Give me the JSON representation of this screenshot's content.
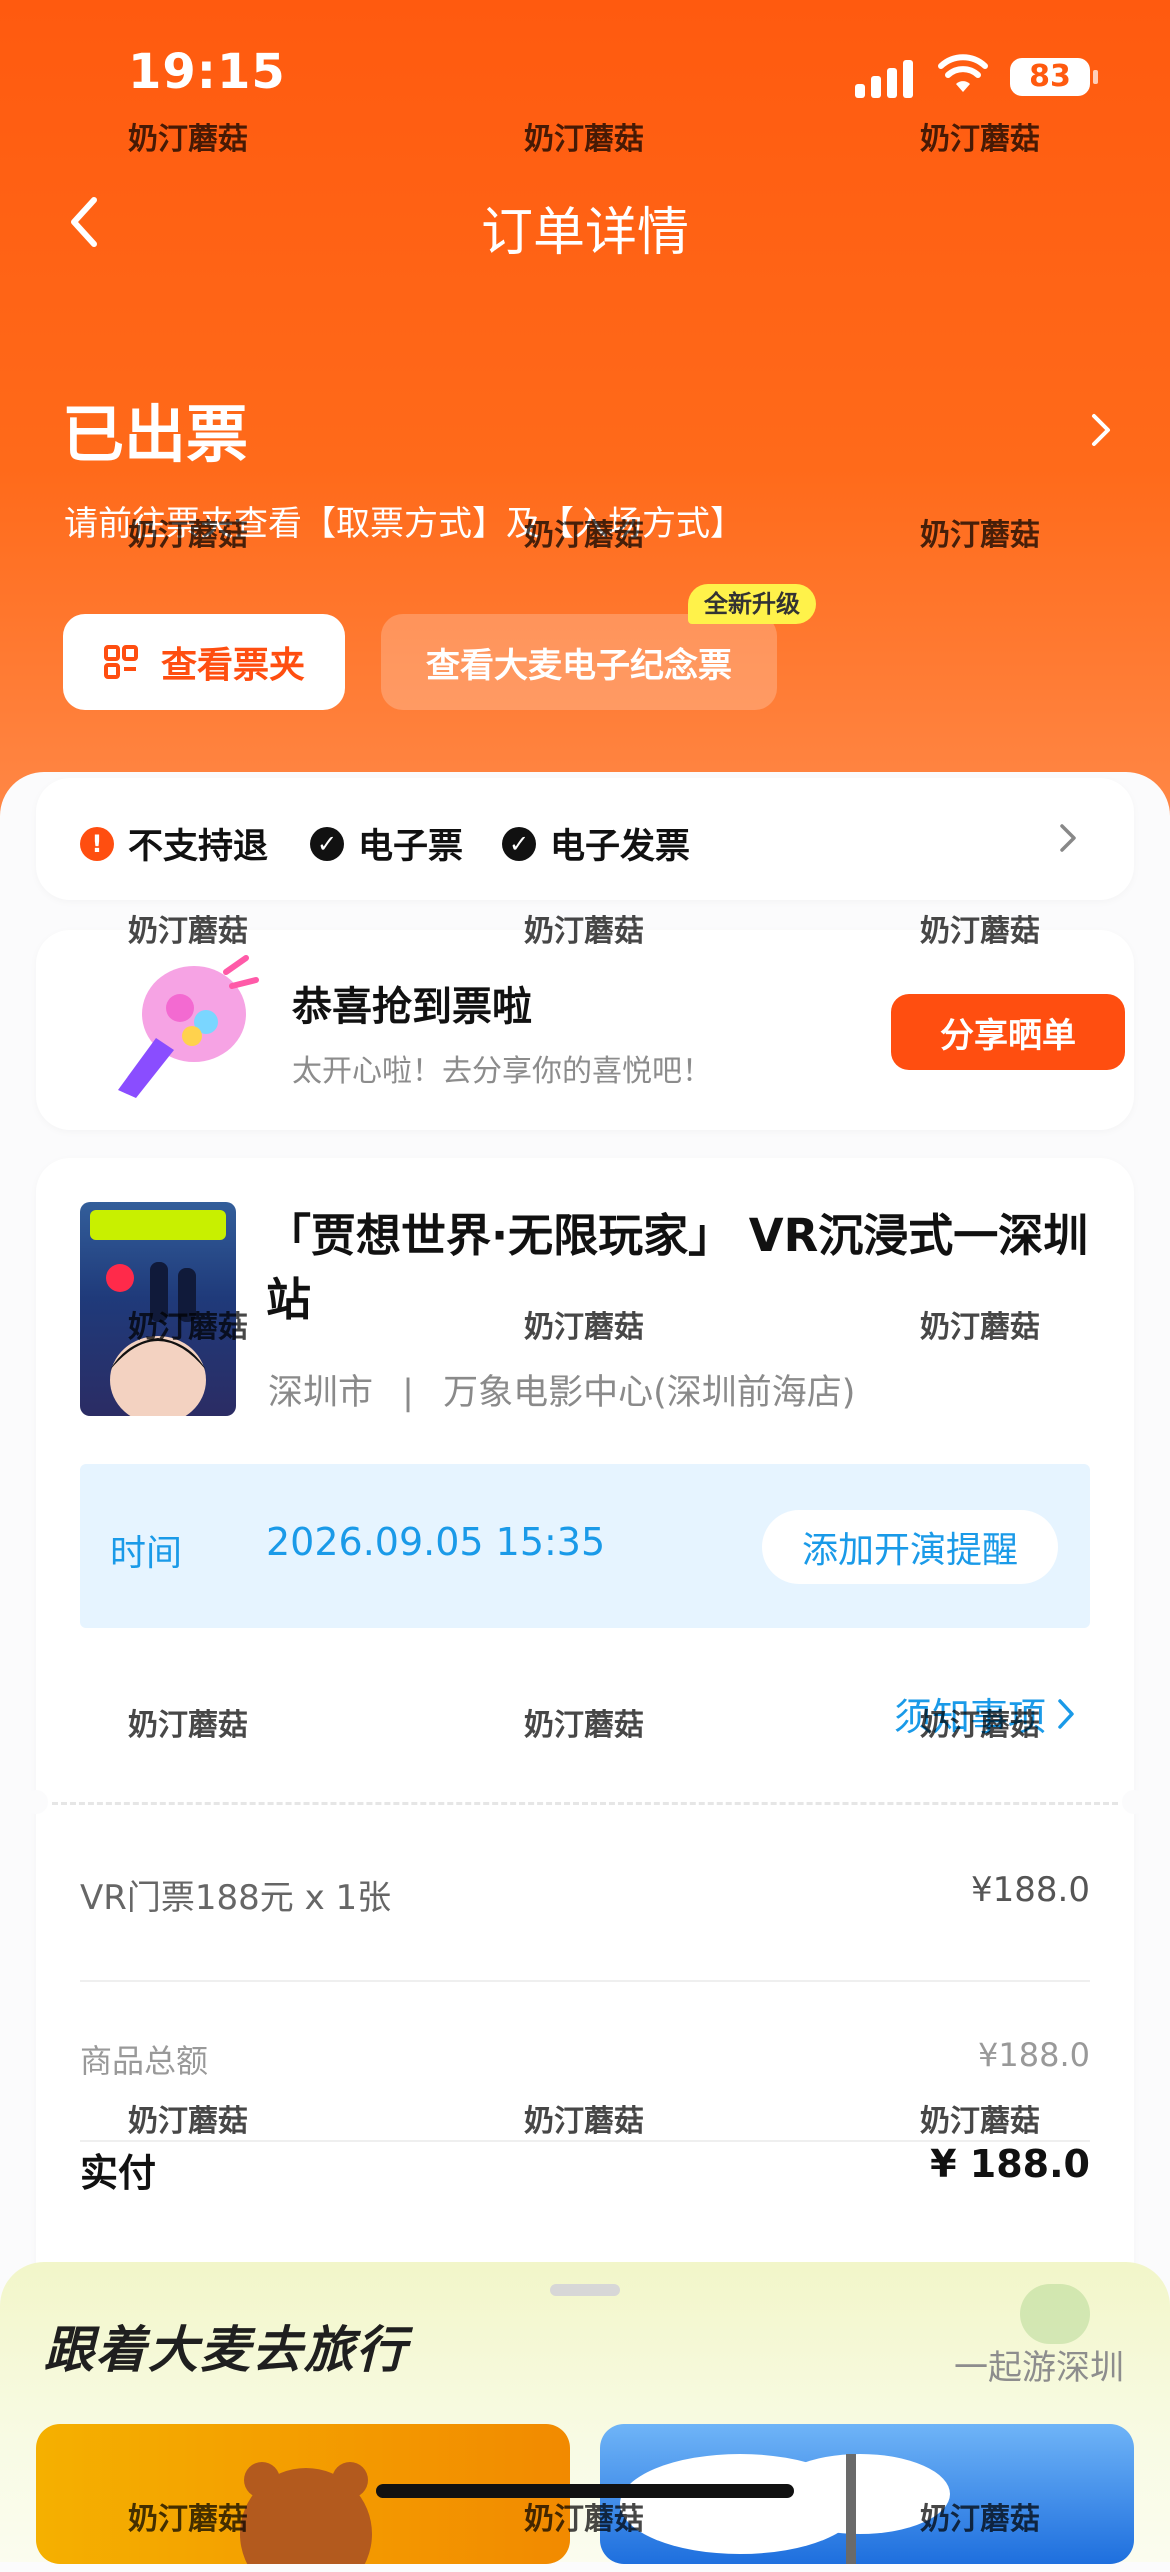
{
  "status_bar": {
    "time": "19:15",
    "battery": "83"
  },
  "header": {
    "title": "订单详情"
  },
  "order_status": {
    "title": "已出票",
    "hint": "请前往票夹查看【取票方式】及【入场方式】"
  },
  "actions": {
    "wallet_label": "查看票夹",
    "souvenir_label": "查看大麦电子纪念票",
    "upgrade_badge": "全新升级"
  },
  "tags": [
    "不支持退",
    "电子票",
    "电子发票"
  ],
  "promo": {
    "title": "恭喜抢到票啦",
    "subtitle": "太开心啦！去分享你的喜悦吧！",
    "share_label": "分享晒单"
  },
  "show": {
    "title": "「贾想世界·无限玩家」 VR沉浸式一深圳站",
    "city": "深圳市",
    "separator": "|",
    "venue": "万象电影中心(深圳前海店)",
    "time_label": "时间",
    "time_value": "2026.09.05 15:35",
    "remind_label": "添加开演提醒",
    "notice_label": "须知事项"
  },
  "pricing": {
    "item_label": "VR门票188元 x 1张",
    "item_price": "¥188.0",
    "subtotal_label": "商品总额",
    "subtotal_value": "¥188.0",
    "paid_label": "实付",
    "paid_value": "¥ 188.0"
  },
  "travel": {
    "title": "跟着大麦去旅行",
    "city_link": "一起游深圳"
  },
  "watermark": "奶汀蘑菇",
  "colors": {
    "brand": "#ff5a0f",
    "accent_blue": "#1a9ae8"
  }
}
